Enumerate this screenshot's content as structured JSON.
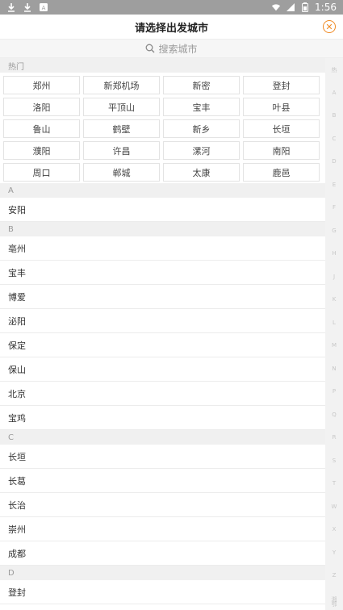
{
  "status": {
    "time": "1:56"
  },
  "header": {
    "title": "请选择出发城市",
    "close_icon": "close-icon"
  },
  "search": {
    "placeholder": "搜索城市"
  },
  "hot": {
    "label": "热门",
    "cities": [
      "郑州",
      "新郑机场",
      "新密",
      "登封",
      "洛阳",
      "平顶山",
      "宝丰",
      "叶县",
      "鲁山",
      "鹤壁",
      "新乡",
      "长垣",
      "濮阳",
      "许昌",
      "漯河",
      "南阳",
      "周口",
      "郸城",
      "太康",
      "鹿邑"
    ]
  },
  "sections": [
    {
      "letter": "A",
      "items": [
        "安阳"
      ]
    },
    {
      "letter": "B",
      "items": [
        "亳州",
        "宝丰",
        "博爱",
        "泌阳",
        "保定",
        "保山",
        "北京",
        "宝鸡"
      ]
    },
    {
      "letter": "C",
      "items": [
        "长垣",
        "长葛",
        "长治",
        "崇州",
        "成都"
      ]
    },
    {
      "letter": "D",
      "items": [
        "登封"
      ]
    }
  ],
  "index": [
    "热",
    "A",
    "B",
    "C",
    "D",
    "E",
    "F",
    "G",
    "H",
    "J",
    "K",
    "L",
    "M",
    "N",
    "P",
    "Q",
    "R",
    "S",
    "T",
    "W",
    "X",
    "Y",
    "Z",
    "湘",
    "鄂"
  ],
  "colors": {
    "accent": "#f08a24",
    "statusbar": "#9e9e9e",
    "sectionbg": "#f0f0f0"
  }
}
